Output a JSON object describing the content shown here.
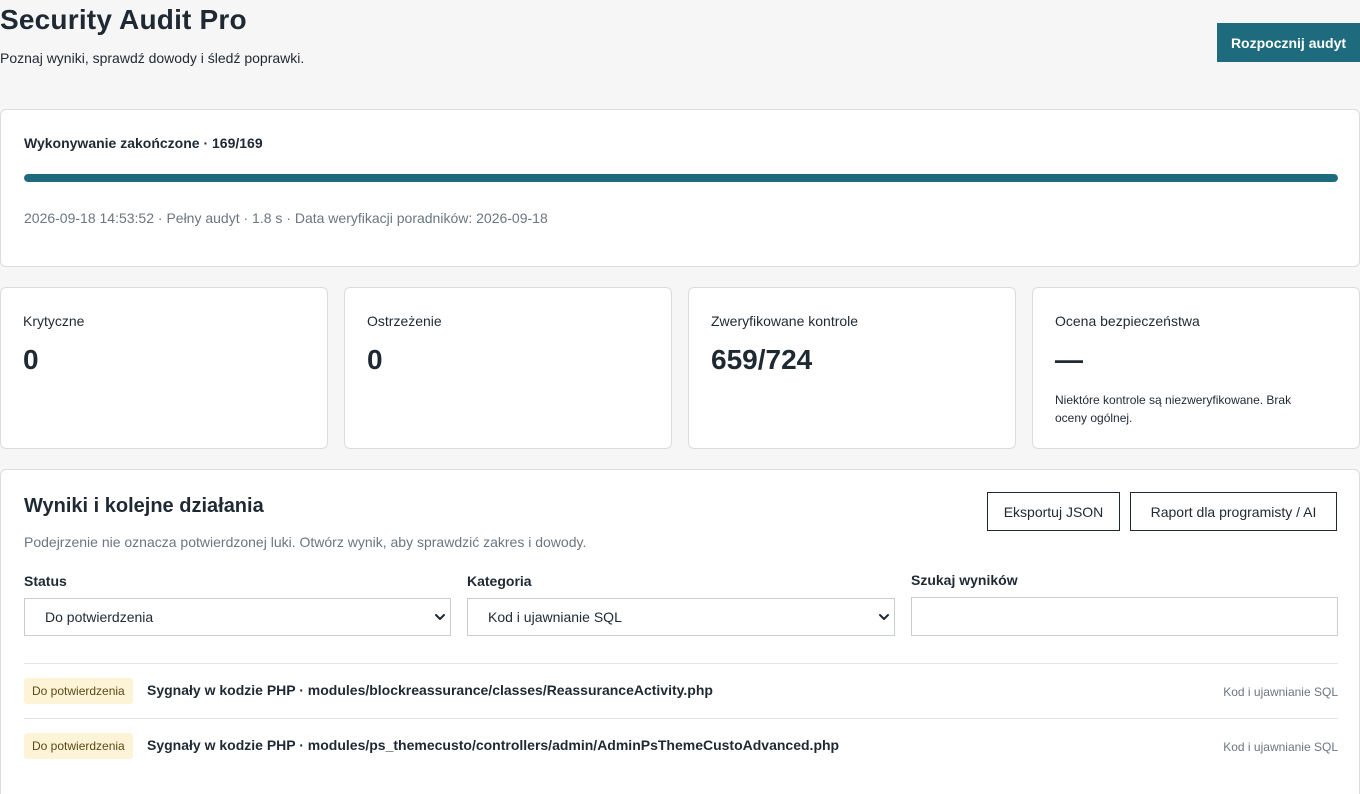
{
  "header": {
    "title": "Security Audit Pro",
    "subtitle": "Poznaj wyniki, sprawdź dowody i śledź poprawki.",
    "start_button": "Rozpocznij audyt"
  },
  "progress": {
    "label": "Wykonywanie zakończone · 169/169",
    "fraction": 1.0,
    "meta": "2026-09-18 14:53:52 · Pełny audyt · 1.8 s · Data weryfikacji poradników: 2026-09-18"
  },
  "stats": [
    {
      "label": "Krytyczne",
      "value": "0",
      "note": ""
    },
    {
      "label": "Ostrzeżenie",
      "value": "0",
      "note": ""
    },
    {
      "label": "Zweryfikowane kontrole",
      "value": "659/724",
      "note": ""
    },
    {
      "label": "Ocena bezpieczeństwa",
      "value": "—",
      "note": "Niektóre kontrole są niezweryfikowane. Brak oceny ogólnej."
    }
  ],
  "results": {
    "title": "Wyniki i kolejne działania",
    "description": "Podejrzenie nie oznacza potwierdzonej luki. Otwórz wynik, aby sprawdzić zakres i dowody.",
    "export_button": "Eksportuj JSON",
    "report_button": "Raport dla programisty / AI",
    "filters": {
      "status_label": "Status",
      "status_value": "Do potwierdzenia",
      "category_label": "Kategoria",
      "category_value": "Kod i ujawnianie SQL",
      "search_label": "Szukaj wyników",
      "search_value": ""
    },
    "rows": [
      {
        "badge": "Do potwierdzenia",
        "title": "Sygnały w kodzie PHP · modules/blockreassurance/classes/ReassuranceActivity.php",
        "category": "Kod i ujawnianie SQL"
      },
      {
        "badge": "Do potwierdzenia",
        "title": "Sygnały w kodzie PHP · modules/ps_themecusto/controllers/admin/AdminPsThemeCustoAdvanced.php",
        "category": "Kod i ujawnianie SQL"
      }
    ]
  },
  "colors": {
    "accent": "#1d6b7c",
    "badge_bg": "#fdf3d6",
    "page_bg": "#f6f6f6"
  }
}
